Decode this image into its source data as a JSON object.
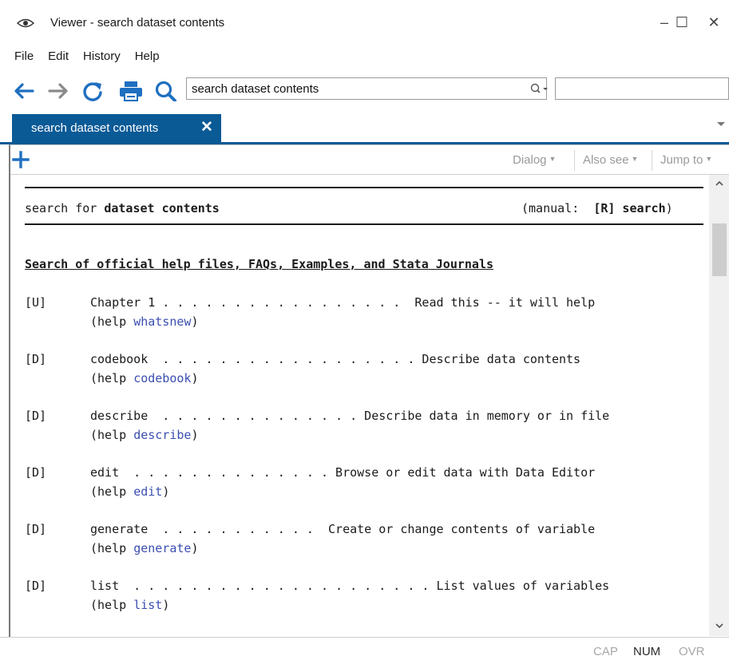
{
  "window": {
    "title": "Viewer - search dataset contents",
    "minimize": "–",
    "maximize": "☐",
    "close": "✕"
  },
  "menu": [
    "File",
    "Edit",
    "History",
    "Help"
  ],
  "toolbar": {
    "address_value": "search dataset contents",
    "search_value": ""
  },
  "tab": {
    "label": "search dataset contents",
    "close": "✕"
  },
  "viewer_toolbar": {
    "dialog": "Dialog",
    "also_see": "Also see",
    "jump_to": "Jump to"
  },
  "doc": {
    "header_prefix": "search for ",
    "header_bold": "dataset contents",
    "manual_prefix": "(manual:  ",
    "manual_link": "[R] search",
    "manual_suffix": ")",
    "section_title": "Search of official help files, FAQs, Examples, and Stata Journals",
    "help_open": "(help ",
    "help_close": ")",
    "entries": [
      {
        "tag": "[U]",
        "line": "Chapter 1 . . . . . . . . . . . . . . . . .  Read this -- it will help",
        "help": "whatsnew"
      },
      {
        "tag": "[D]",
        "line": "codebook  . . . . . . . . . . . . . . . . . . Describe data contents",
        "help": "codebook"
      },
      {
        "tag": "[D]",
        "line": "describe  . . . . . . . . . . . . . . Describe data in memory or in file",
        "help": "describe"
      },
      {
        "tag": "[D]",
        "line": "edit  . . . . . . . . . . . . . . Browse or edit data with Data Editor",
        "help": "edit"
      },
      {
        "tag": "[D]",
        "line": "generate  . . . . . . . . . . .  Create or change contents of variable",
        "help": "generate"
      },
      {
        "tag": "[D]",
        "line": "list  . . . . . . . . . . . . . . . . . . . . . List values of variables",
        "help": "list"
      }
    ]
  },
  "status": {
    "cap": "CAP",
    "num": "NUM",
    "ovr": "OVR"
  },
  "colors": {
    "accent": "#0a5a96",
    "link": "#3a4fb0",
    "arrow_blue": "#1f6fc0"
  }
}
